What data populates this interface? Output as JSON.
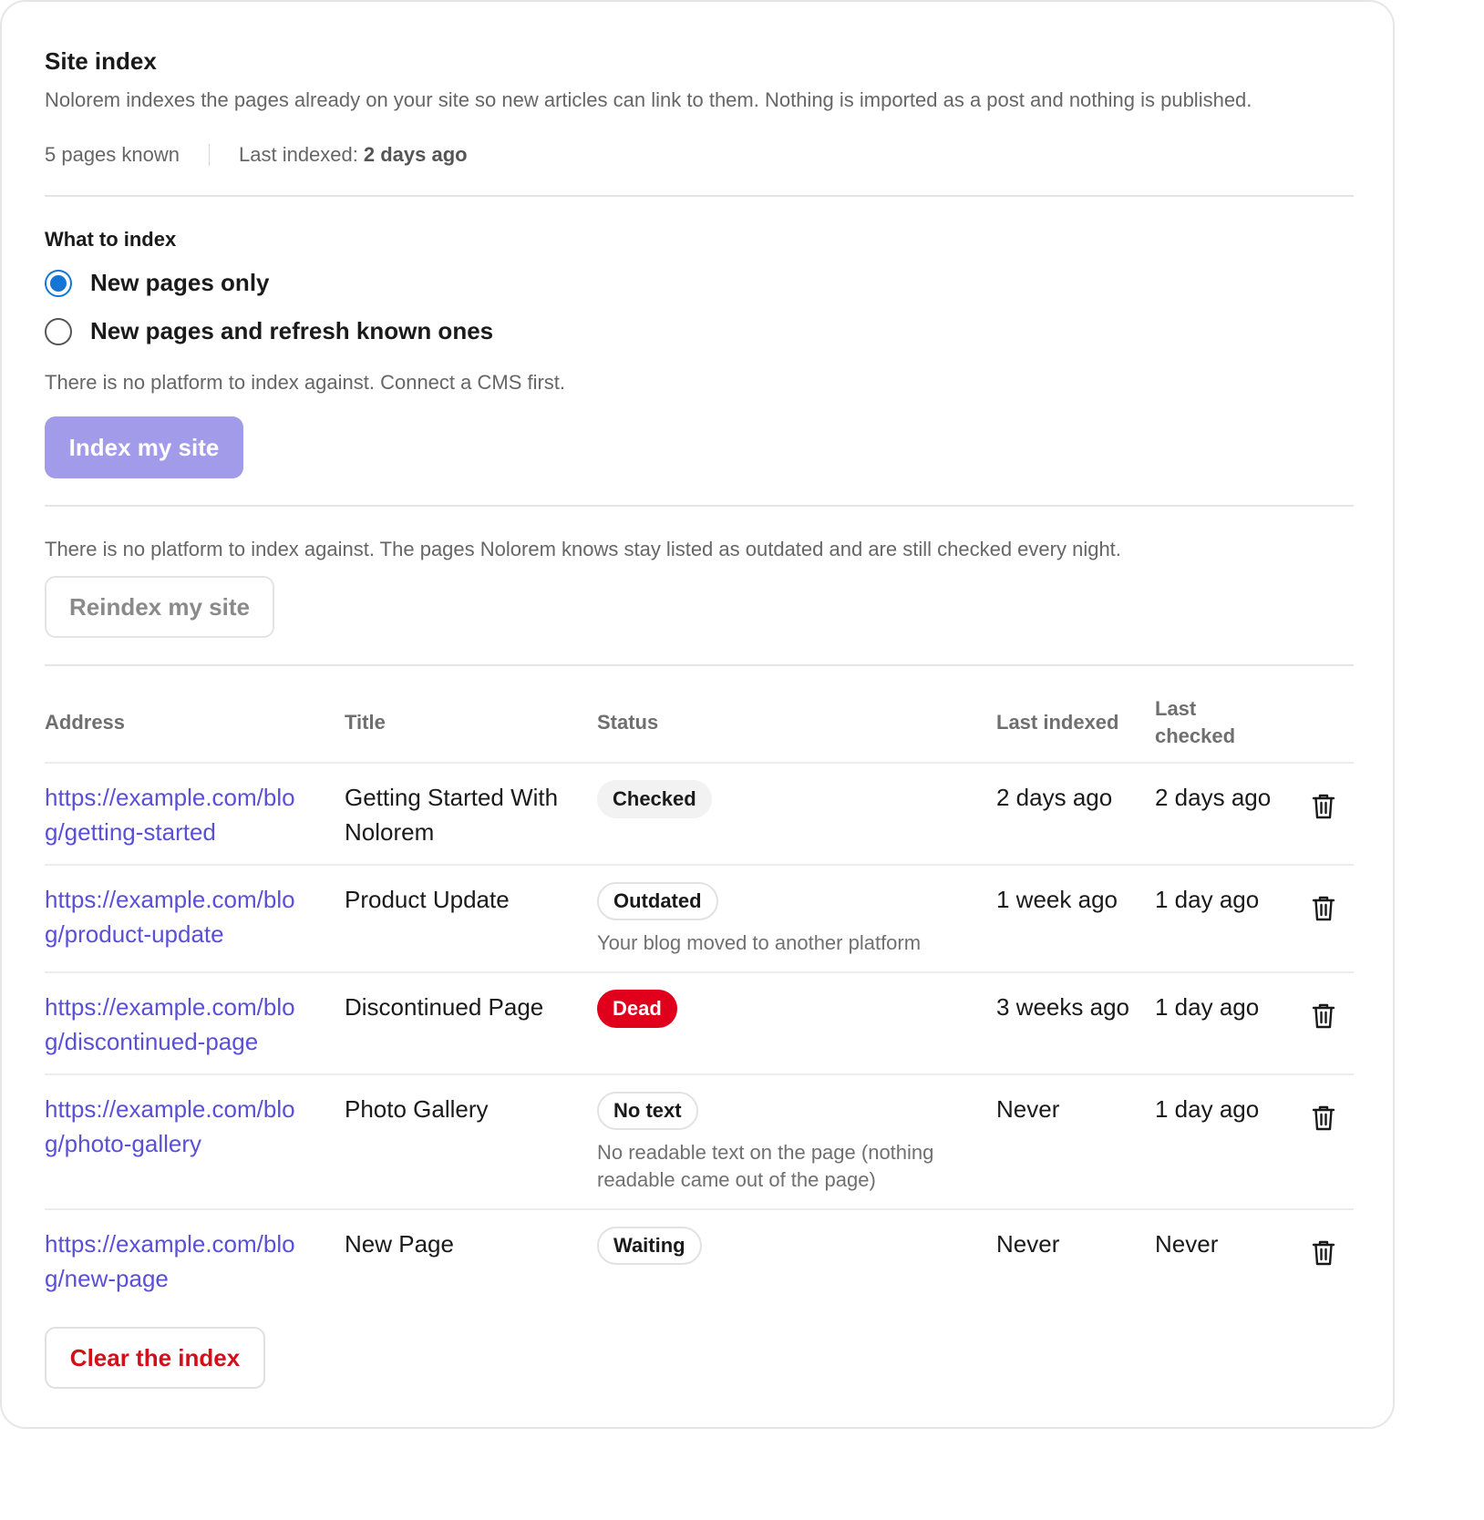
{
  "header": {
    "title": "Site index",
    "description": "Nolorem indexes the pages already on your site so new articles can link to them. Nothing is imported as a post and nothing is published.",
    "pages_known": "5 pages known",
    "last_indexed_label": "Last indexed:",
    "last_indexed_value": "2 days ago"
  },
  "options": {
    "label": "What to index",
    "choices": [
      {
        "label": "New pages only",
        "selected": true
      },
      {
        "label": "New pages and refresh known ones",
        "selected": false
      }
    ],
    "hint": "There is no platform to index against. Connect a CMS first.",
    "index_button": "Index my site"
  },
  "reindex": {
    "hint": "There is no platform to index against. The pages Nolorem knows stay listed as outdated and are still checked every night.",
    "button": "Reindex my site"
  },
  "table": {
    "headers": {
      "address": "Address",
      "title": "Title",
      "status": "Status",
      "last_indexed": "Last indexed",
      "last_checked": "Last checked"
    },
    "rows": [
      {
        "address": "https://example.com/blog/getting-started",
        "title": "Getting Started With Nolorem",
        "status": "Checked",
        "status_kind": "checked",
        "note": "",
        "last_indexed": "2 days ago",
        "last_checked": "2 days ago"
      },
      {
        "address": "https://example.com/blog/product-update",
        "title": "Product Update",
        "status": "Outdated",
        "status_kind": "outline",
        "note": "Your blog moved to another platform",
        "last_indexed": "1 week ago",
        "last_checked": "1 day ago"
      },
      {
        "address": "https://example.com/blog/discontinued-page",
        "title": "Discontinued Page",
        "status": "Dead",
        "status_kind": "dead",
        "note": "",
        "last_indexed": "3 weeks ago",
        "last_checked": "1 day ago"
      },
      {
        "address": "https://example.com/blog/photo-gallery",
        "title": "Photo Gallery",
        "status": "No text",
        "status_kind": "outline",
        "note": "No readable text on the page (nothing readable came out of the page)",
        "last_indexed": "Never",
        "last_checked": "1 day ago"
      },
      {
        "address": "https://example.com/blog/new-page",
        "title": "New Page",
        "status": "Waiting",
        "status_kind": "outline",
        "note": "",
        "last_indexed": "Never",
        "last_checked": "Never"
      }
    ]
  },
  "clear_button": "Clear the index",
  "colors": {
    "accent": "#1475d4",
    "primary_button": "#a29be9",
    "link": "#5a4fd6",
    "danger": "#e0001b"
  },
  "icons": {
    "delete": "trash-icon"
  }
}
